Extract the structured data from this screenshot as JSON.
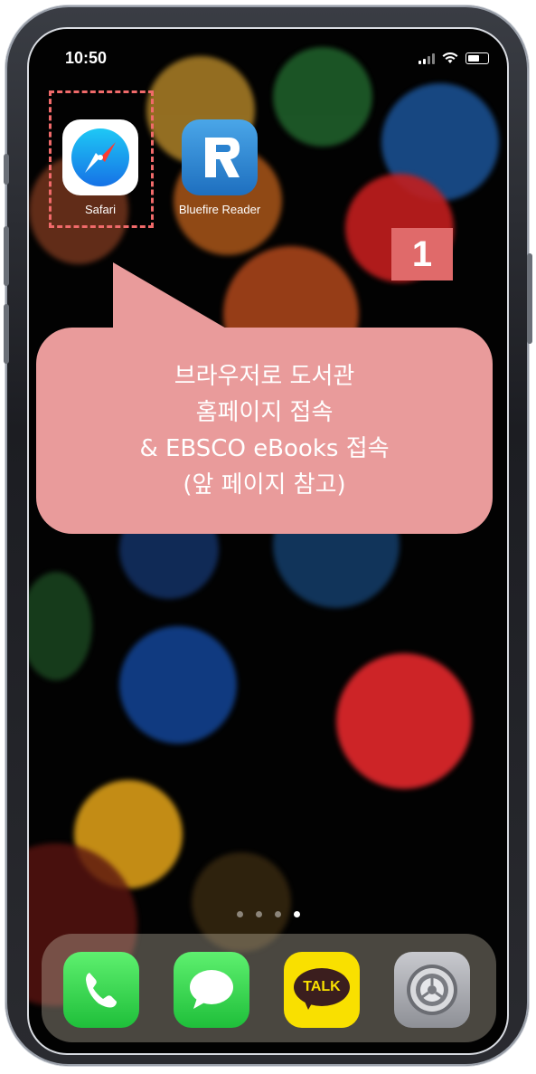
{
  "status_bar": {
    "time": "10:50"
  },
  "apps": [
    {
      "label": "Safari"
    },
    {
      "label": "Bluefire Reader"
    }
  ],
  "step_badge": "1",
  "callout": {
    "lines": [
      "브라우저로 도서관",
      "홈페이지 접속",
      "& EBSCO eBooks 접속",
      "(앞 페이지 참고)"
    ]
  },
  "page_indicator": {
    "count": 4,
    "active": 4
  },
  "dock": {
    "kakao_label": "TALK"
  },
  "colors": {
    "highlight": "#f06a6a",
    "badge": "#e06a6a",
    "callout": "#e99b9b"
  }
}
